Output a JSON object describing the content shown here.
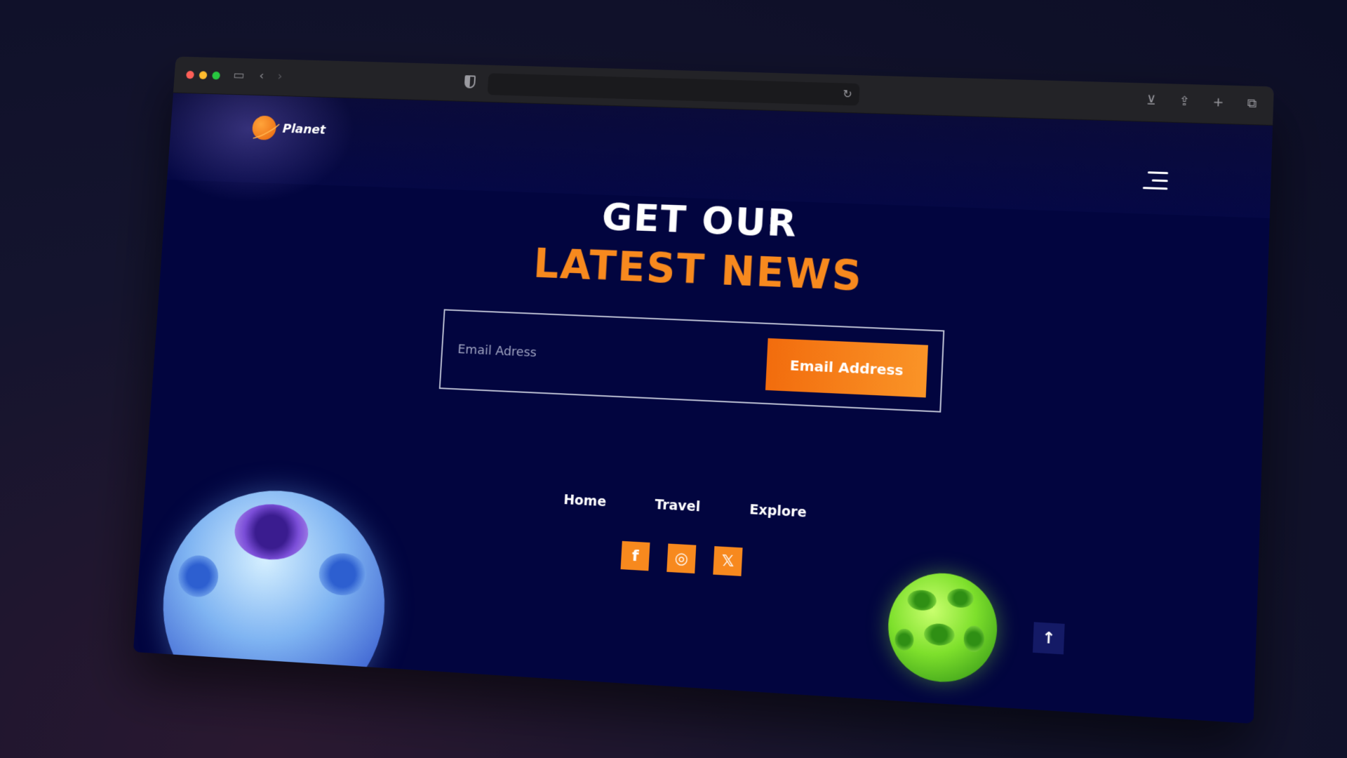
{
  "browser": {
    "title": "",
    "url": ""
  },
  "brand": {
    "name": "Planet",
    "accent_color": "#f7891e",
    "background_color": "#02053f"
  },
  "hero": {
    "line1": "GET OUR",
    "line2": "LATEST NEWS"
  },
  "subscribe": {
    "email_placeholder": "Email Adress",
    "button_label": "Email Address"
  },
  "footer": {
    "nav": [
      "Home",
      "Travel",
      "Explore"
    ],
    "socials": [
      {
        "icon": "facebook-icon",
        "glyph": "f"
      },
      {
        "icon": "instagram-icon",
        "glyph": "◎"
      },
      {
        "icon": "x-icon",
        "glyph": "𝕏"
      }
    ]
  },
  "icons": {
    "menu": "hamburger-icon",
    "back_to_top": "arrow-up-icon",
    "back_to_top_glyph": "↑"
  }
}
